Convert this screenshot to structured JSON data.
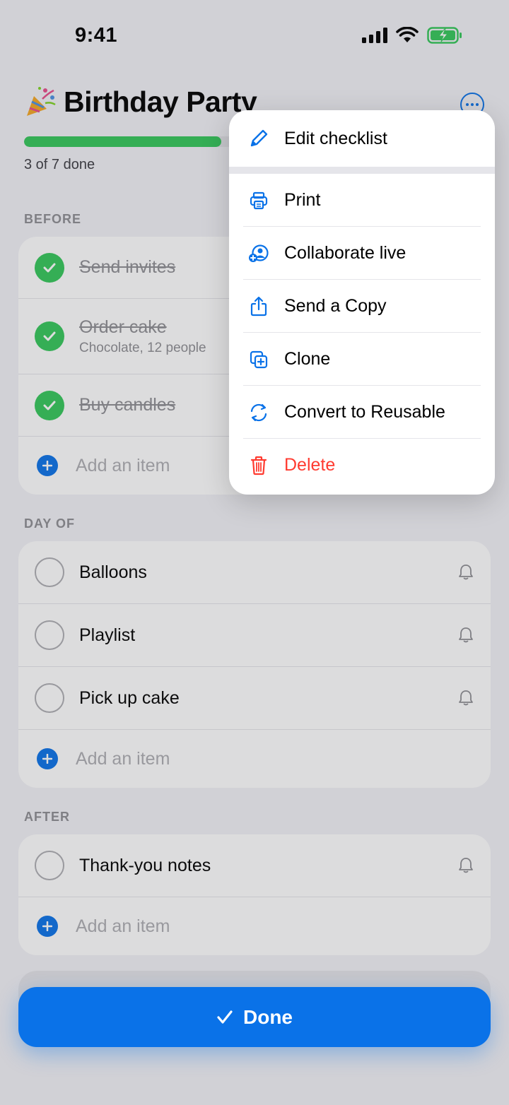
{
  "status_bar": {
    "time": "9:41"
  },
  "header": {
    "emoji_icon": "party-popper-icon",
    "title": "Birthday Party",
    "progress": {
      "done": 3,
      "total": 7,
      "fraction": 0.4286,
      "text": "3 of 7 done"
    },
    "more_icon": "ellipsis-circle-icon"
  },
  "sections": [
    {
      "label": "BEFORE",
      "items": [
        {
          "text": "Send invites",
          "done": true
        },
        {
          "text": "Order cake",
          "subtitle": "Chocolate, 12 people",
          "done": true
        },
        {
          "text": "Buy candles",
          "done": true
        }
      ],
      "add_label": "Add an item"
    },
    {
      "label": "DAY OF",
      "items": [
        {
          "text": "Balloons",
          "done": false
        },
        {
          "text": "Playlist",
          "done": false
        },
        {
          "text": "Pick up cake",
          "done": false
        }
      ],
      "add_label": "Add an item"
    },
    {
      "label": "AFTER",
      "items": [
        {
          "text": "Thank-you notes",
          "done": false
        }
      ],
      "add_label": "Add an item"
    }
  ],
  "menu": {
    "items": [
      {
        "label": "Edit checklist",
        "icon": "pencil-icon"
      },
      {
        "label": "Print",
        "icon": "printer-icon"
      },
      {
        "label": "Collaborate live",
        "icon": "person-badge-plus-icon"
      },
      {
        "label": "Send a Copy",
        "icon": "share-icon"
      },
      {
        "label": "Clone",
        "icon": "duplicate-icon"
      },
      {
        "label": "Convert to Reusable",
        "icon": "arrows-cycle-icon"
      },
      {
        "label": "Delete",
        "icon": "trash-icon",
        "destructive": true
      }
    ]
  },
  "footer": {
    "done_label": "Done"
  },
  "colors": {
    "accent": "#0a72e8",
    "success": "#34c759",
    "destructive": "#ff3b30"
  }
}
